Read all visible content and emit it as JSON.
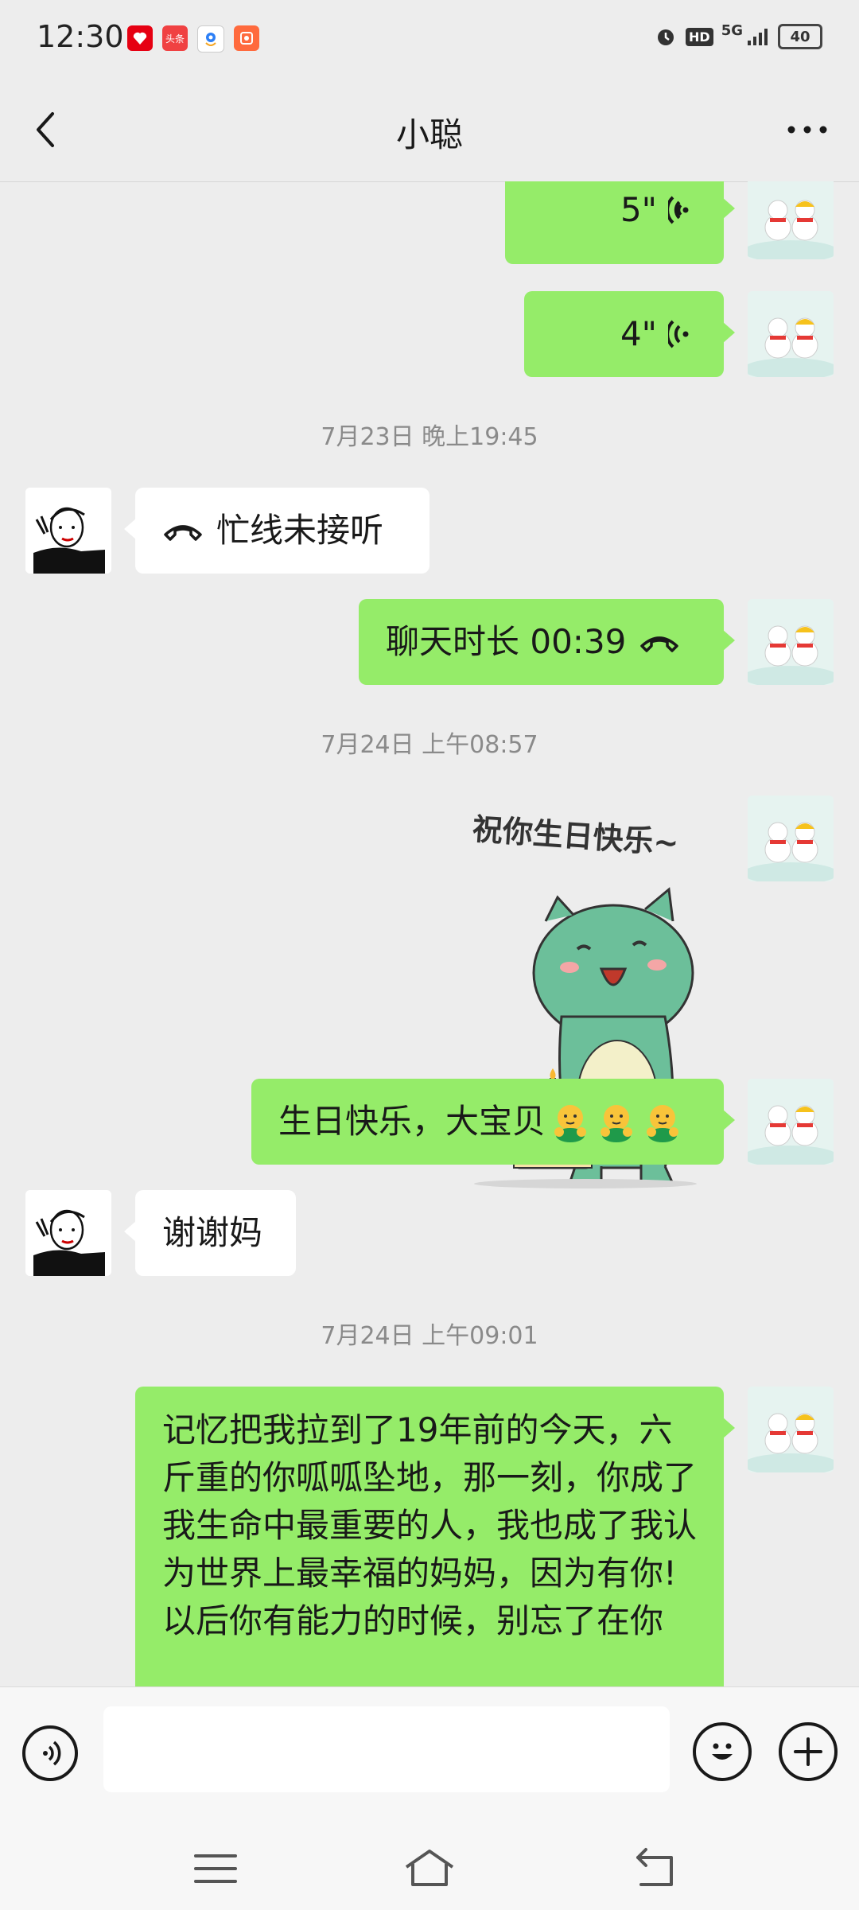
{
  "status_bar": {
    "time": "12:30",
    "apps": [
      {
        "icon": "red-app-icon",
        "color": "#e60012"
      },
      {
        "icon": "toutiao-icon",
        "label": "头条",
        "color": "#f04142"
      },
      {
        "icon": "location-app-icon",
        "color": "#2c7ff6"
      },
      {
        "icon": "orange-app-icon",
        "color": "#ff6a3d"
      }
    ],
    "network": "5G",
    "hd_label": "HD",
    "battery": "40"
  },
  "header": {
    "title": "小聪"
  },
  "messages": {
    "voice1_duration": "5\"",
    "voice2_duration": "4\"",
    "ts1": "7月23日 晚上19:45",
    "missed_call": "忙线未接听",
    "call_duration": "聊天时长 00:39",
    "ts2": "7月24日 上午08:57",
    "sticker_caption": "祝你生日快乐~",
    "birthday_msg": "生日快乐，大宝贝",
    "thanks": "谢谢妈",
    "ts3": "7月24日 上午09:01",
    "long_msg": "记忆把我拉到了19年前的今天，六斤重的你呱呱坠地，那一刻，你成了我生命中最重要的人，我也成了我认为世界上最幸福的妈妈，因为有你!\n以后你有能力的时候，别忘了在你"
  },
  "input_bar": {
    "input_value": ""
  },
  "colors": {
    "my_bubble": "#95ec69",
    "other_bubble": "#ffffff",
    "background": "#ededed"
  }
}
